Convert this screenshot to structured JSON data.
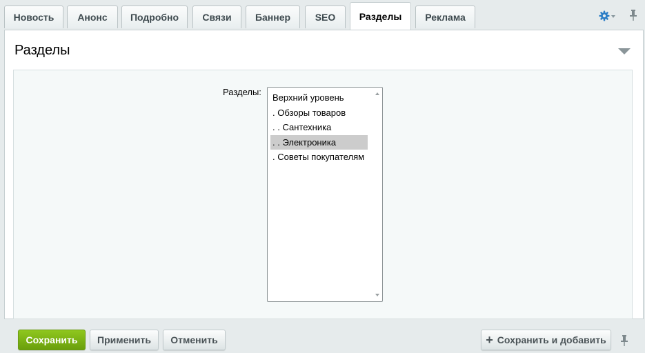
{
  "tabs": [
    {
      "label": "Новость"
    },
    {
      "label": "Анонс"
    },
    {
      "label": "Подробно"
    },
    {
      "label": "Связи"
    },
    {
      "label": "Баннер"
    },
    {
      "label": "SEO"
    },
    {
      "label": "Разделы",
      "active": true
    },
    {
      "label": "Реклама"
    }
  ],
  "icons": {
    "settings": "gear-icon",
    "pin": "pin-icon",
    "collapse": "triangle-down-icon"
  },
  "colors": {
    "accent_green": "#7ab317",
    "gear_blue": "#2a7dc6",
    "selected_option_bg": "#cccccc"
  },
  "section": {
    "title": "Разделы",
    "field_label": "Разделы:",
    "options": [
      {
        "label": "Верхний уровень",
        "selected": false
      },
      {
        "label": ". Обзоры товаров",
        "selected": false
      },
      {
        "label": ". . Сантехника",
        "selected": false
      },
      {
        "label": ". . Электроника",
        "selected": true
      },
      {
        "label": ". Советы покупателям",
        "selected": false
      }
    ]
  },
  "buttons": {
    "save": "Сохранить",
    "apply": "Применить",
    "cancel": "Отменить",
    "save_and_add": "Сохранить и добавить"
  }
}
